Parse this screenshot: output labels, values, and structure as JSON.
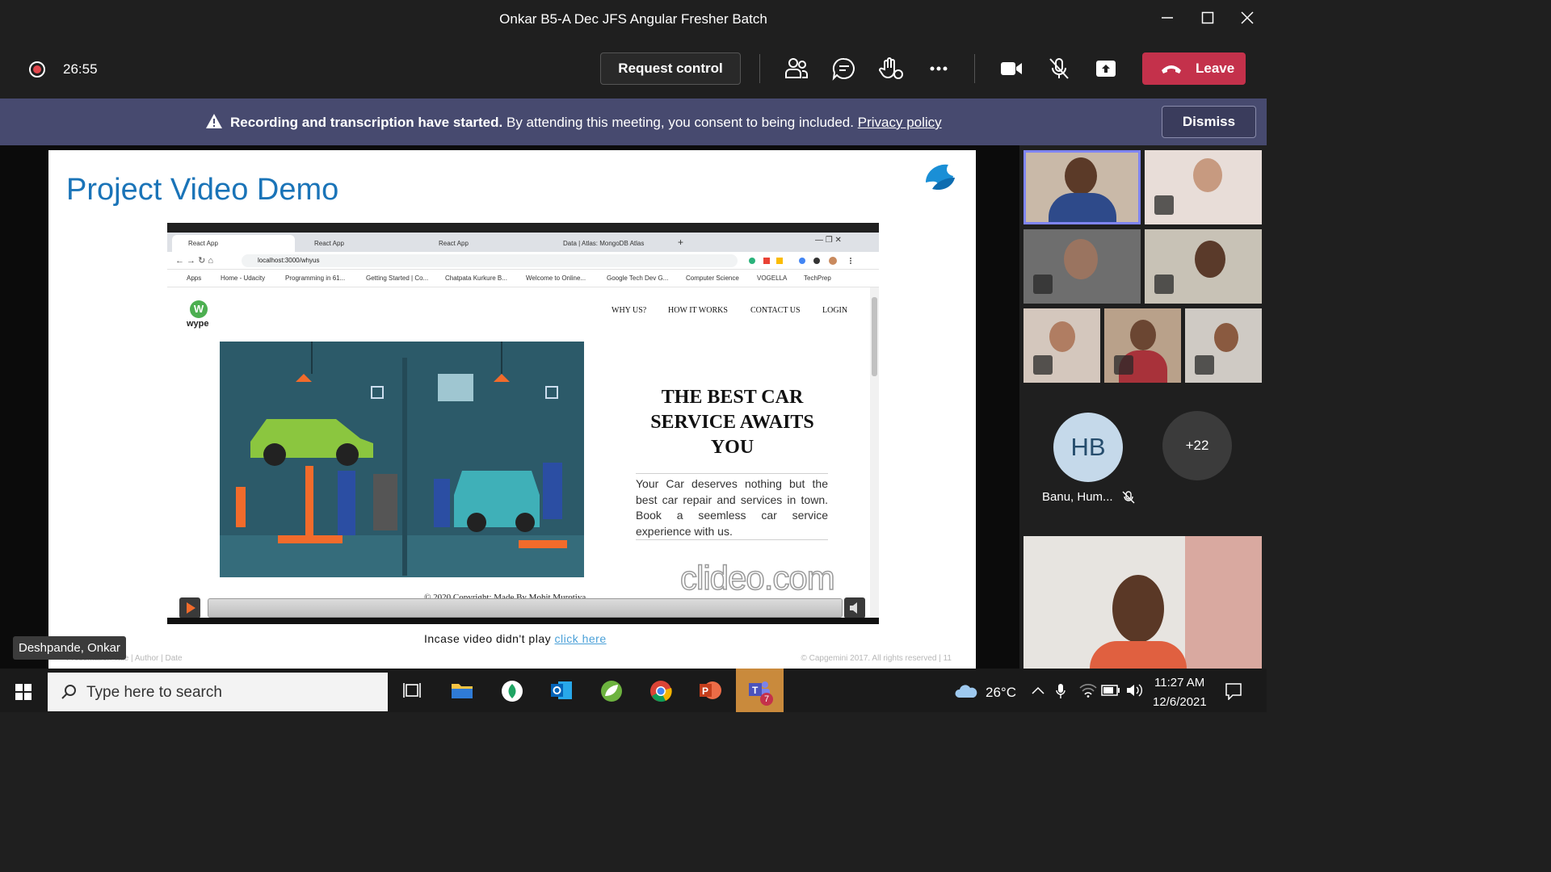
{
  "window": {
    "title": "Onkar B5-A Dec JFS Angular Fresher Batch"
  },
  "toolbar": {
    "timer": "26:55",
    "request_control": "Request control",
    "leave": "Leave"
  },
  "banner": {
    "bold": "Recording and transcription have started.",
    "text": "By attending this meeting, you consent to being included.",
    "link": "Privacy policy",
    "dismiss": "Dismiss"
  },
  "slide": {
    "title": "Project Video Demo",
    "incase_text": "Incase video didn't play",
    "incase_link": "click here",
    "footer_left": "Presentation Title | Author | Date",
    "footer_right": "© Capgemini 2017. All rights reserved  |  11"
  },
  "browser": {
    "tabs": [
      "React App",
      "React App",
      "React App",
      "Data | Atlas: MongoDB Atlas"
    ],
    "url": "localhost:3000/whyus",
    "bookmarks": [
      "Apps",
      "Home - Udacity",
      "Programming in 61...",
      "Getting Started | Co...",
      "Chatpata Kurkure B...",
      "Welcome to Online...",
      "Google Tech Dev G...",
      "Computer Science",
      "VOGELLA",
      "TechPrep"
    ]
  },
  "site": {
    "logo_letter": "W",
    "logo_text": "wype",
    "nav": [
      "WHY US?",
      "HOW IT WORKS",
      "CONTACT US",
      "LOGIN"
    ],
    "headline": "THE BEST CAR SERVICE AWAITS YOU",
    "body": "Your Car deserves nothing but the best car repair and services in town. Book a seemless car service experience with us.",
    "copyright": "© 2020 Copyright: Made By Mohit Murotiya",
    "watermark": "clideo.com"
  },
  "presenter": {
    "name": "Deshpande, Onkar"
  },
  "participants": {
    "hb_initials": "HB",
    "hb_name": "Banu, Hum...",
    "more_count": "+22"
  },
  "taskbar": {
    "search_placeholder": "Type here to search",
    "weather": "26°C",
    "time": "11:27 AM",
    "date": "12/6/2021",
    "teams_badge": "7"
  }
}
